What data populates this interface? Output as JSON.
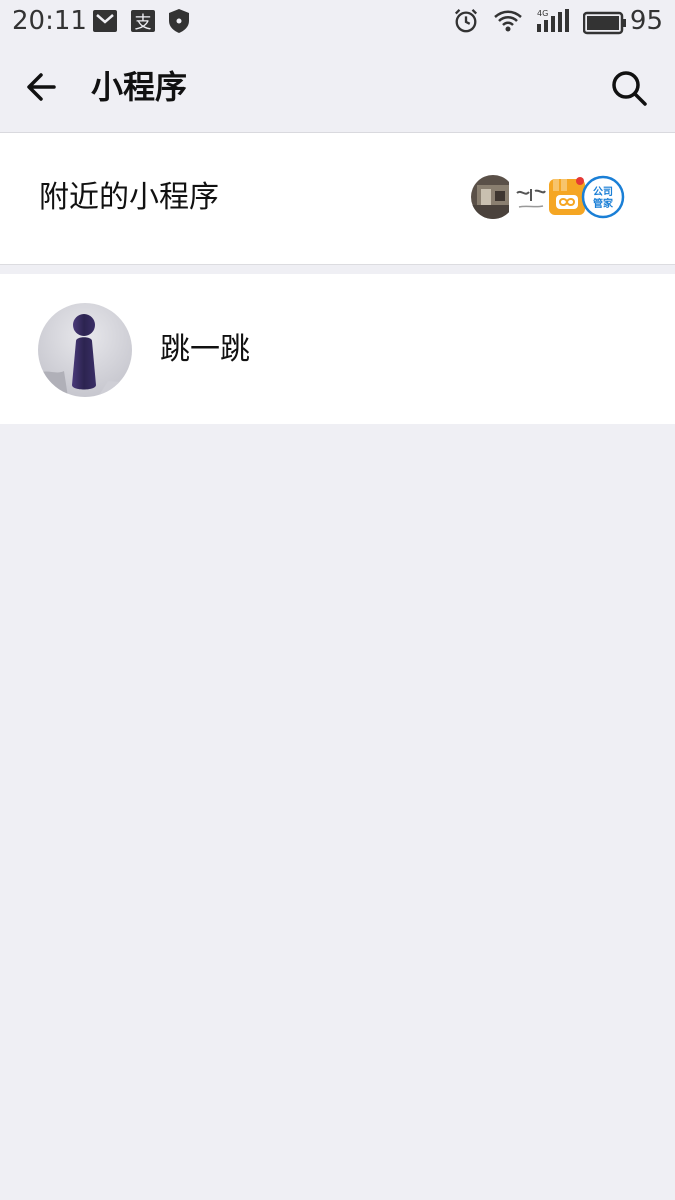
{
  "status_bar": {
    "time": "20:11",
    "left_icons": [
      "mail-icon",
      "alipay-icon",
      "shield-icon"
    ],
    "right_icons": [
      "alarm-icon",
      "wifi-icon",
      "signal-4g-icon",
      "battery-icon"
    ],
    "network": "4G",
    "battery": "95"
  },
  "header": {
    "title": "小程序",
    "back_icon": "back-arrow-icon",
    "search_icon": "search-icon"
  },
  "nearby": {
    "label": "附近的小程序",
    "icons": [
      "nearby-photo-icon",
      "nearby-calligraphy-icon",
      "nearby-orange-app-icon",
      "nearby-company-icon"
    ],
    "company_icon_text": "公司管家"
  },
  "list": {
    "items": [
      {
        "name": "跳一跳",
        "icon": "jump-piece-icon"
      }
    ]
  },
  "colors": {
    "background": "#efeff4",
    "row_background": "#ffffff",
    "text": "#111111",
    "orange": "#f5a623",
    "company_blue": "#1a7fd6"
  }
}
